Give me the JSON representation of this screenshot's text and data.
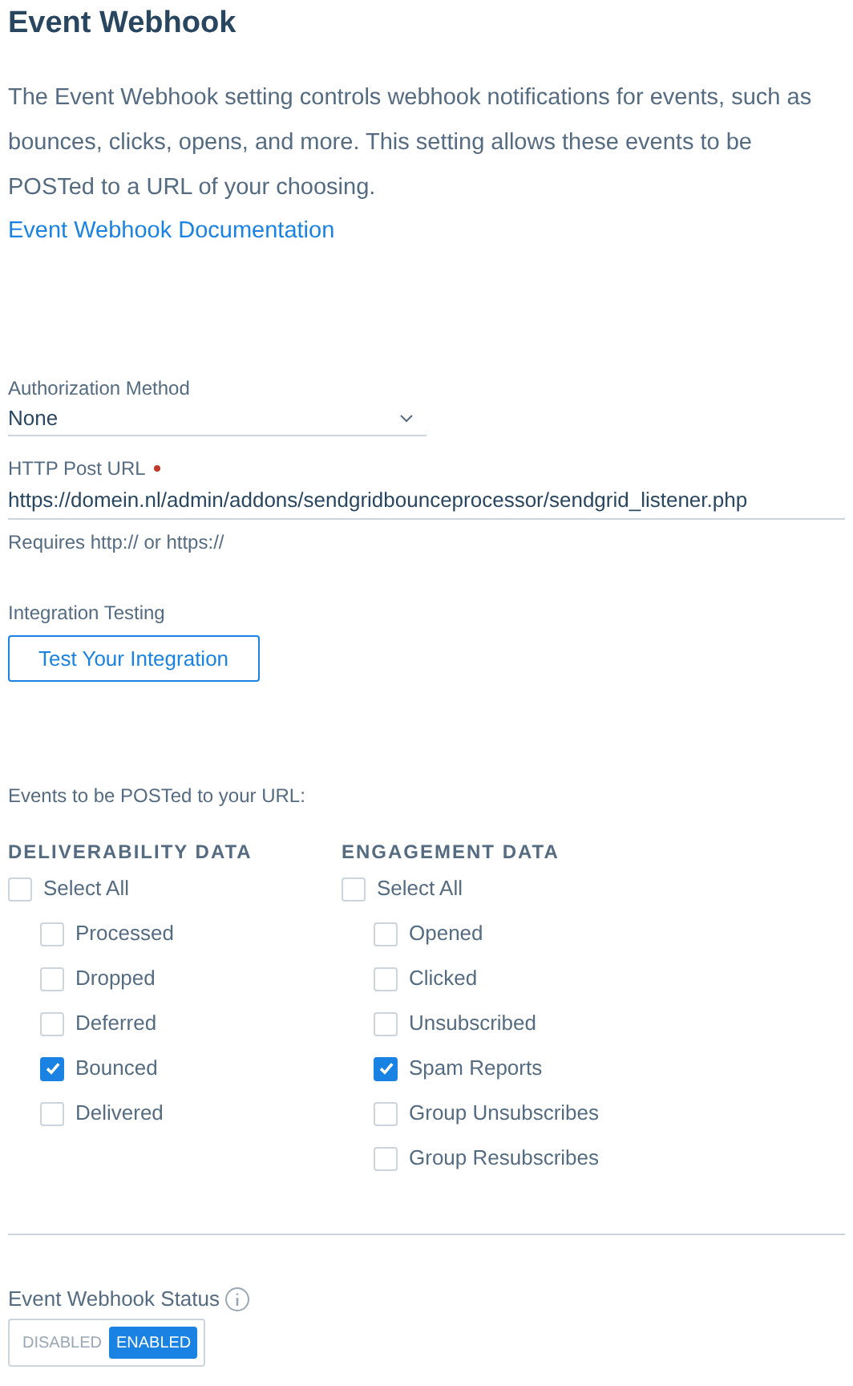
{
  "title": "Event Webhook",
  "description": "The Event Webhook setting controls webhook notifications for events, such as bounces, clicks, opens, and more. This setting allows these events to be POSTed to a URL of your choosing.",
  "documentation_link": "Event Webhook Documentation",
  "authorization": {
    "label": "Authorization Method",
    "value": "None"
  },
  "post_url": {
    "label": "HTTP Post URL",
    "required": true,
    "value": "https://domein.nl/admin/addons/sendgridbounceprocessor/sendgrid_listener.php",
    "help": "Requires http:// or https://"
  },
  "integration": {
    "label": "Integration Testing",
    "button": "Test Your Integration"
  },
  "events_label": "Events to be POSTed to your URL:",
  "groups": [
    {
      "heading": "DELIVERABILITY DATA",
      "select_all": {
        "label": "Select All",
        "checked": false
      },
      "items": [
        {
          "label": "Processed",
          "checked": false
        },
        {
          "label": "Dropped",
          "checked": false
        },
        {
          "label": "Deferred",
          "checked": false
        },
        {
          "label": "Bounced",
          "checked": true
        },
        {
          "label": "Delivered",
          "checked": false
        }
      ]
    },
    {
      "heading": "ENGAGEMENT DATA",
      "select_all": {
        "label": "Select All",
        "checked": false
      },
      "items": [
        {
          "label": "Opened",
          "checked": false
        },
        {
          "label": "Clicked",
          "checked": false
        },
        {
          "label": "Unsubscribed",
          "checked": false
        },
        {
          "label": "Spam Reports",
          "checked": true
        },
        {
          "label": "Group Unsubscribes",
          "checked": false
        },
        {
          "label": "Group Resubscribes",
          "checked": false
        }
      ]
    }
  ],
  "status": {
    "label": "Event Webhook Status",
    "options": [
      {
        "label": "DISABLED",
        "selected": false
      },
      {
        "label": "ENABLED",
        "selected": true
      }
    ]
  }
}
